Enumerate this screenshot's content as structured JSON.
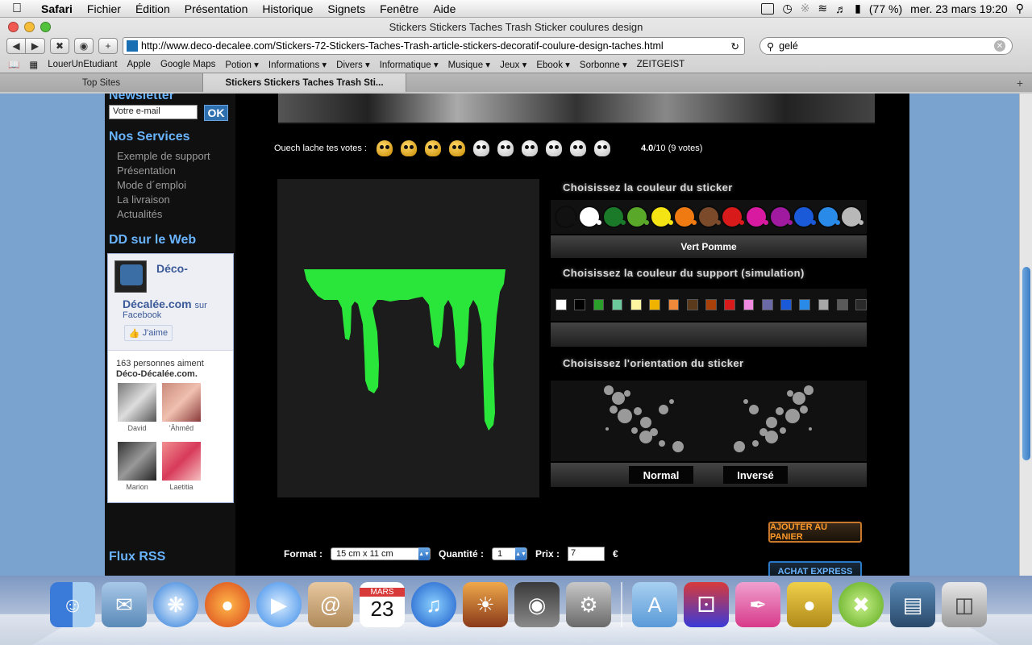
{
  "menubar": {
    "apple": "",
    "items": [
      "Safari",
      "Fichier",
      "Édition",
      "Présentation",
      "Historique",
      "Signets",
      "Fenêtre",
      "Aide"
    ],
    "battery": "(77 %)",
    "datetime": "mer. 23 mars  19:20"
  },
  "window": {
    "title": "Stickers Stickers Taches Trash Sticker coulures design"
  },
  "toolbar": {
    "url": "http://www.deco-decalee.com/Stickers-72-Stickers-Taches-Trash-article-stickers-decoratif-coulure-design-taches.html",
    "search_value": "gelé"
  },
  "bookmarks": [
    "LouerUnEtudiant",
    "Apple",
    "Google Maps",
    "Potion ▾",
    "Informations ▾",
    "Divers ▾",
    "Informatique ▾",
    "Musique ▾",
    "Jeux ▾",
    "Ebook ▾",
    "Sorbonne ▾",
    "ZEITGEIST"
  ],
  "tabs": [
    {
      "label": "Top Sites"
    },
    {
      "label": "Stickers Stickers Taches Trash Sti..."
    }
  ],
  "sidebar": {
    "newsletter_heading": "Newsletter",
    "newsletter_placeholder": "Votre e-mail",
    "ok_label": "OK",
    "services_heading": "Nos Services",
    "services": [
      "Exemple de support",
      "Présentation",
      "Mode d´emploi",
      "La livraison",
      "Actualités"
    ],
    "web_heading": "DD sur le Web",
    "fb_name_1": "Déco-",
    "fb_name_2": "Décalée.com",
    "fb_sur": "sur",
    "fb_facebook": "Facebook",
    "fb_like": "J'aime",
    "fb_count_text": "163 personnes aiment",
    "fb_count_page": "Déco-Décalée.com.",
    "fb_faces": [
      "David",
      "'Âhmêd",
      "Marion",
      "Laetitia"
    ],
    "rss_heading": "Flux RSS"
  },
  "votes": {
    "label": "Ouech lache tes votes :",
    "score_bold": "4.0",
    "score_rest": "/10 (9 votes)",
    "stars_filled": 4,
    "stars_total": 10
  },
  "options": {
    "sticker_color_title": "Choisissez la couleur du sticker",
    "sticker_colors": [
      "#111111",
      "#ffffff",
      "#1a7a2a",
      "#5aa82a",
      "#f5e414",
      "#f07a12",
      "#7a4a2a",
      "#d81a1a",
      "#d81aa0",
      "#a01aa0",
      "#1a5ad8",
      "#2a8ae8",
      "#b8b8b8"
    ],
    "selected_color_name": "Vert Pomme",
    "support_color_title": "Choisissez la couleur du support (simulation)",
    "support_colors": [
      "#ffffff",
      "#000000",
      "#2aa02a",
      "#6ac89a",
      "#fff5a0",
      "#f0b400",
      "#f08a3a",
      "#5a3a1a",
      "#a8400a",
      "#d81a1a",
      "#f08ae0",
      "#6a6aa8",
      "#1a5ad8",
      "#2a8ae8",
      "#a8a8a8",
      "#5a5a5a",
      "#2a2a2a"
    ],
    "orientation_title": "Choisissez l'orientation du sticker",
    "orientation_normal": "Normal",
    "orientation_inverse": "Inversé"
  },
  "purchase": {
    "format_label": "Format :",
    "format_value": "15 cm x 11 cm",
    "quantity_label": "Quantité :",
    "quantity_value": "1",
    "price_label": "Prix :",
    "price_value": "7",
    "currency": "€",
    "add_to_cart": "AJOUTER AU PANIER",
    "express": "ACHAT EXPRESS"
  },
  "dock": [
    "Finder",
    "Mail",
    "Safari",
    "Firefox",
    "iChat",
    "Carnet d'adresses",
    "iCal",
    "iTunes",
    "iPhoto",
    "Photo Booth",
    "Préférences Système",
    "Applications",
    "Jeux",
    "Plume",
    "Compteur",
    "Xbox",
    "Documents",
    "Corbeille"
  ],
  "dock_ical": {
    "month": "MARS",
    "day": "23"
  },
  "colors": {
    "sticker_green": "#2ae63a",
    "page_background": "#7aa3cf",
    "heading_blue": "#6ab4ff"
  }
}
